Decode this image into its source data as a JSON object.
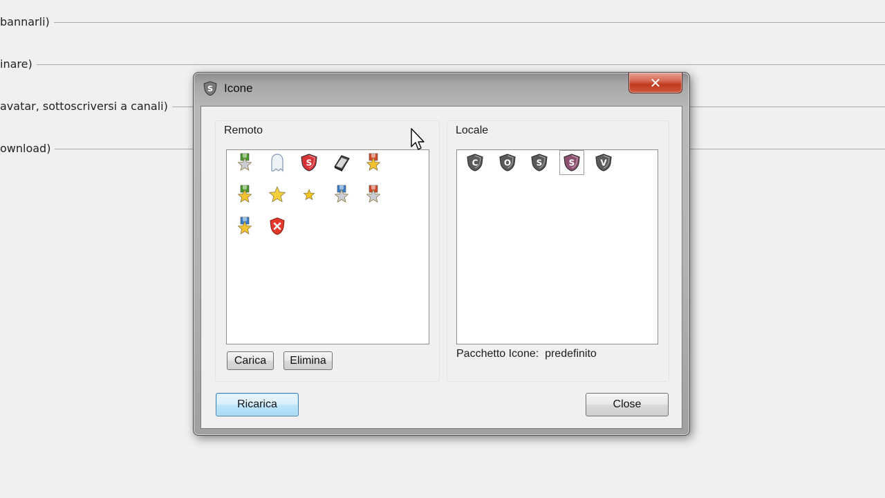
{
  "background": {
    "rows": [
      {
        "text": "bannarli)"
      },
      {
        "text": "inare)"
      },
      {
        "text": "avatar, sottoscriversi a canali)"
      },
      {
        "text": "ownload)"
      }
    ]
  },
  "dialog": {
    "title": "Icone",
    "close_glyph": "✕",
    "remote": {
      "title": "Remoto",
      "icons": [
        "green-ribbon-silver-star-icon",
        "ghost-icon",
        "red-shield-s-icon",
        "book-icon",
        "red-ribbon-gold-star-icon",
        "green-ribbon-gold-star-icon",
        "gold-star-icon",
        "small-gold-star-icon",
        "blue-ribbon-silver-star-icon",
        "red-ribbon-silver-star-icon",
        "blue-ribbon-gold-star-icon",
        "red-x-shield-icon"
      ],
      "buttons": {
        "load": "Carica",
        "delete": "Elimina"
      }
    },
    "local": {
      "title": "Locale",
      "icons": [
        "shield-c-icon",
        "shield-o-icon",
        "shield-s-icon",
        "shield-s-purple-icon",
        "shield-v-icon"
      ],
      "selected_index": 3,
      "pack_label": "Pacchetto Icone:",
      "pack_value": "predefinito"
    },
    "buttons": {
      "reload": "Ricarica",
      "close": "Close"
    }
  },
  "colors": {
    "accent": "#3c7fb1",
    "close_red": "#c0391f",
    "shield_purple": "#8e5070",
    "shield_gray": "#555555"
  }
}
